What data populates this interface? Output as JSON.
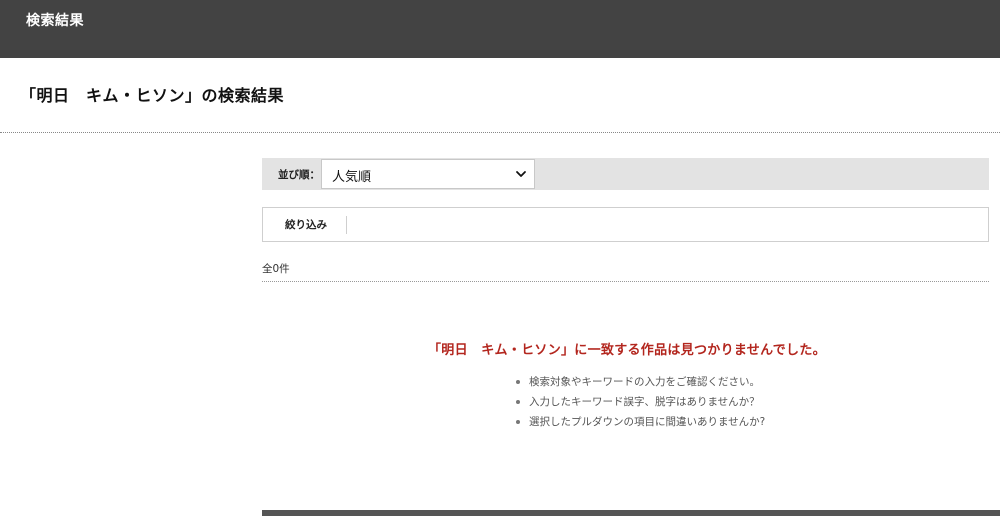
{
  "header": {
    "title": "検索結果"
  },
  "page": {
    "title": "「明日　キム・ヒソン」の検索結果"
  },
  "sort": {
    "label": "並び順：",
    "selected": "人気順"
  },
  "filter": {
    "label": "絞り込み"
  },
  "results": {
    "count_text": "全0件",
    "no_result_message": "「明日　キム・ヒソン」に一致する作品は見つかりませんでした。",
    "tips": [
      "検索対象やキーワードの入力をご確認ください。",
      "入力したキーワード誤字、脱字はありませんか？",
      "選択したプルダウンの項目に間違いありませんか?"
    ]
  },
  "icons": {
    "sort_chevron": "chevron-down-icon"
  },
  "colors": {
    "header_bg": "#434343",
    "no_result_text": "#b3261e",
    "sortbar_bg": "#e3e3e3"
  }
}
